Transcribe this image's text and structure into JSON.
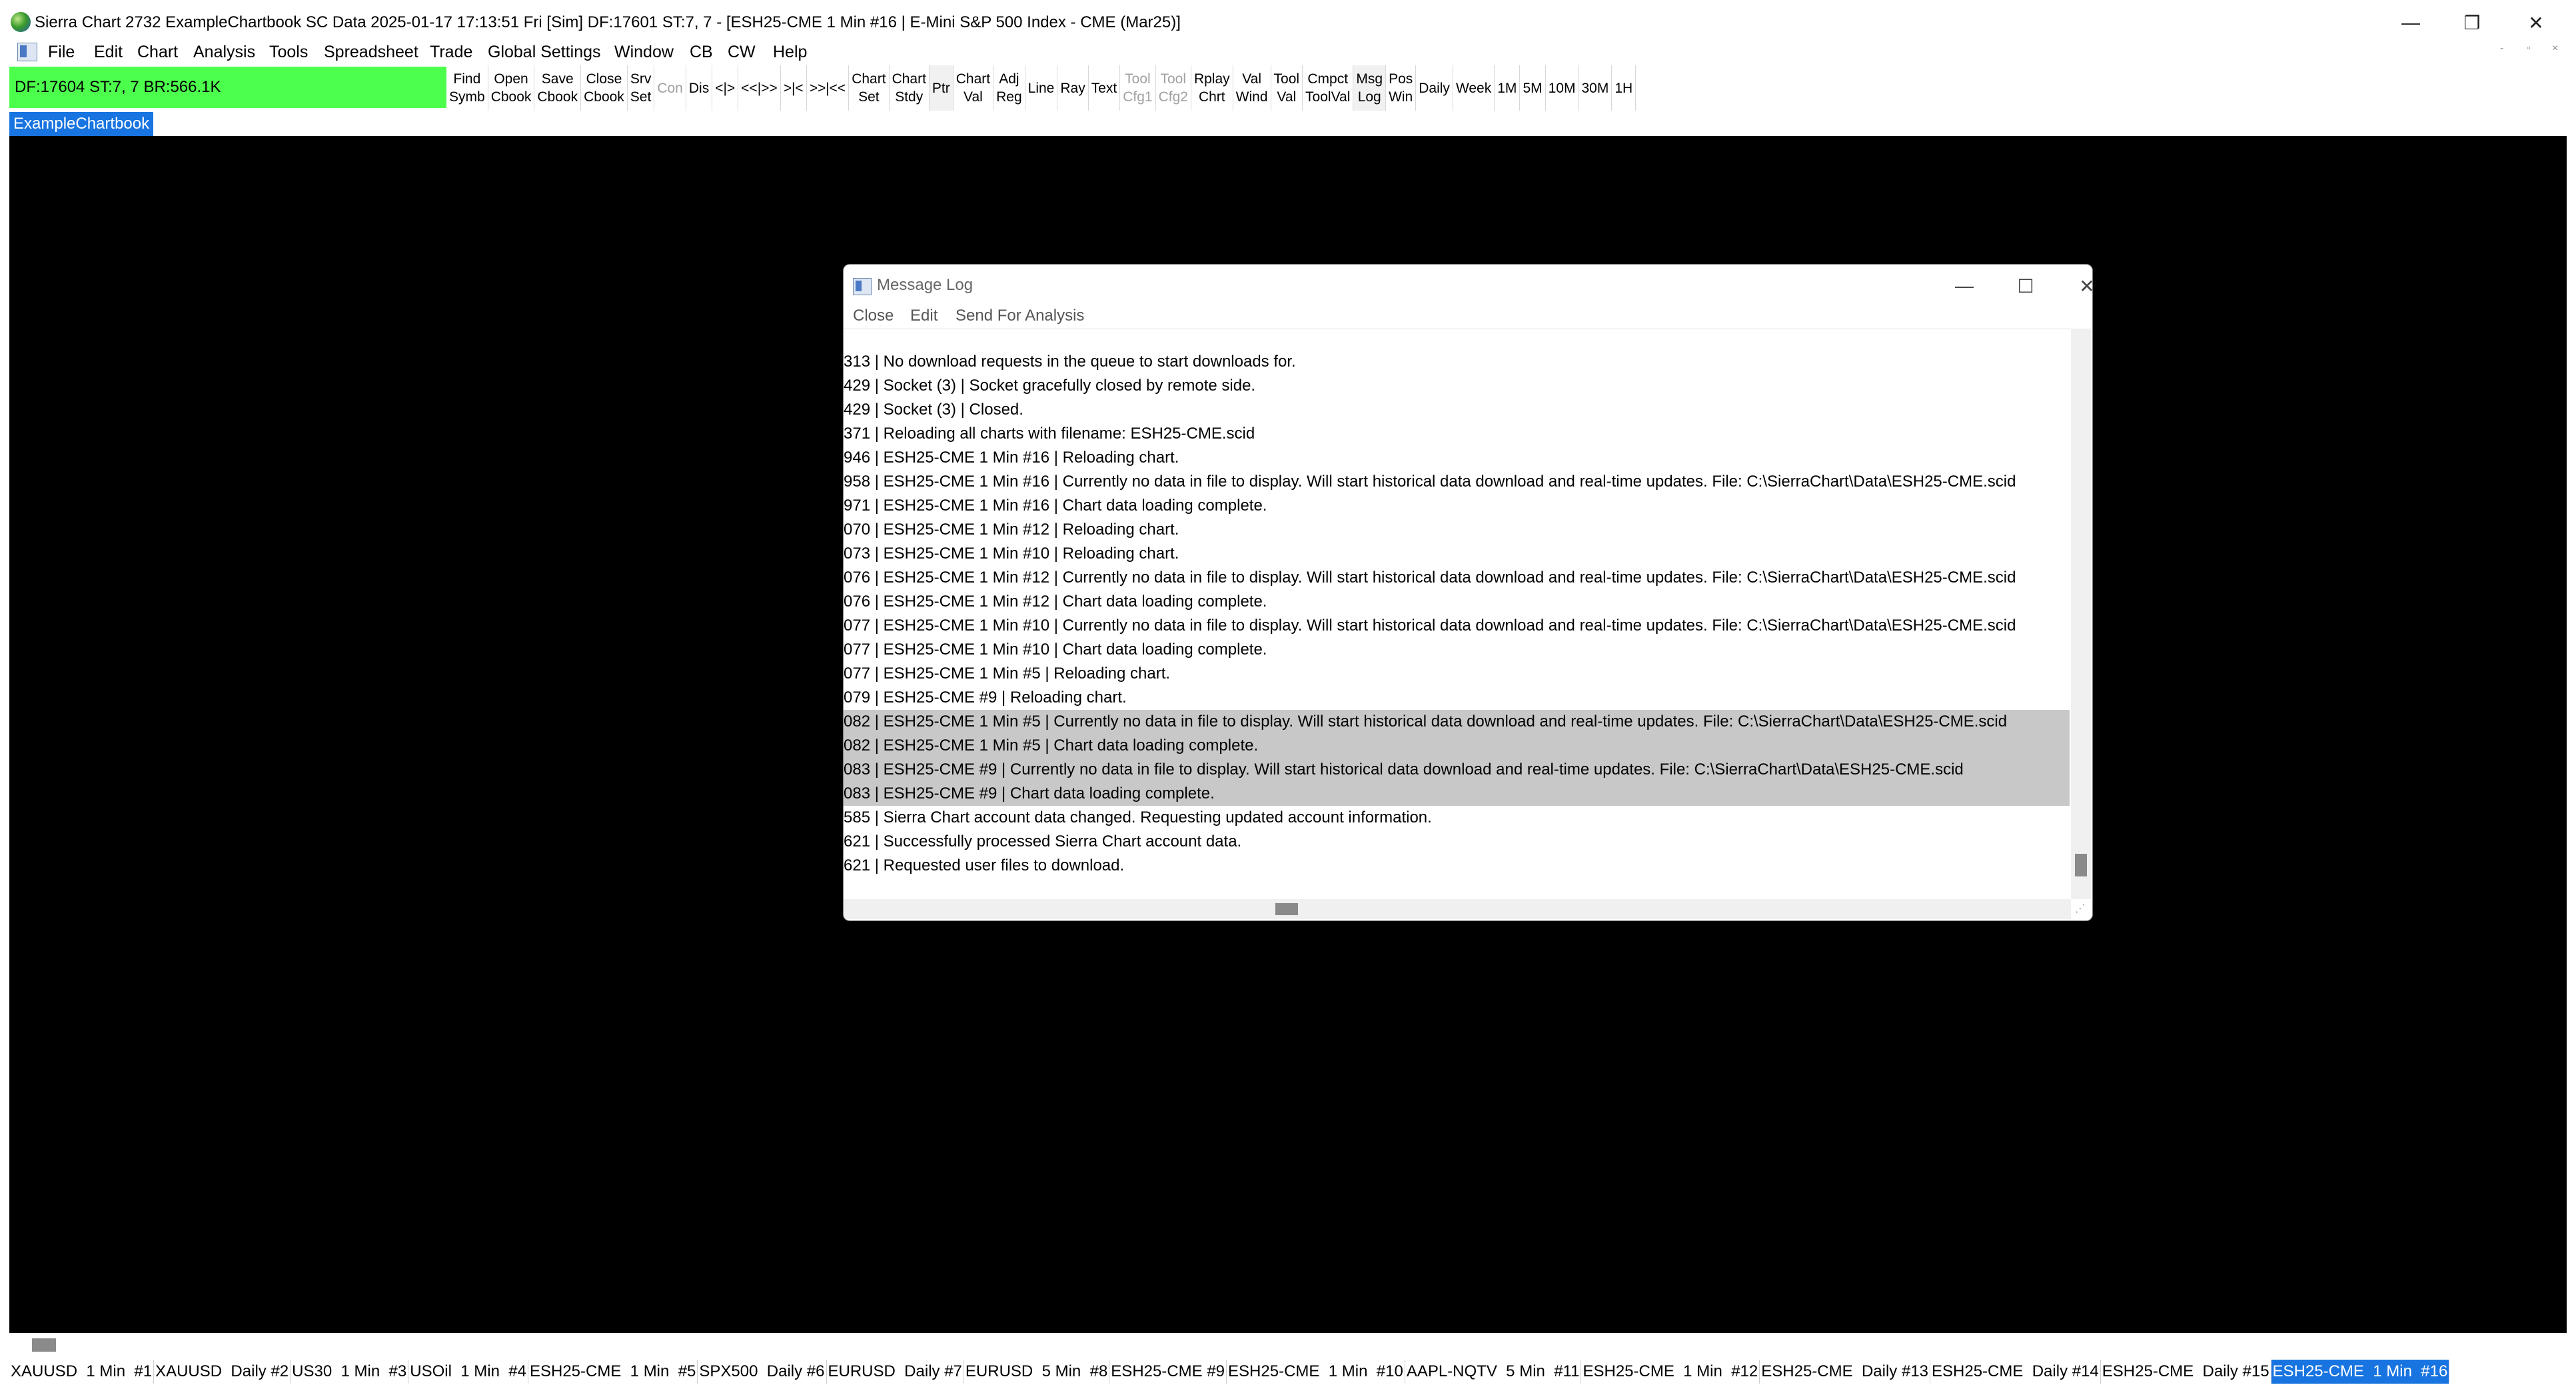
{
  "window": {
    "title": "Sierra Chart 2732 ExampleChartbook SC Data 2025-01-17  17:13:51 Fri [Sim] DF:17601  ST:7, 7 - [ESH25-CME  1 Min  #16 | E-Mini S&P 500 Index - CME (Mar25)]",
    "min_glyph": "—",
    "max_glyph": "❐",
    "close_glyph": "✕"
  },
  "menu": {
    "items": [
      "File",
      "Edit",
      "Chart",
      "Analysis",
      "Tools",
      "Spreadsheet",
      "Trade",
      "Global Settings",
      "Window",
      "CB",
      "CW",
      "Help"
    ],
    "mdi_min": "-",
    "mdi_restore": "▫",
    "mdi_close": "×"
  },
  "status": {
    "text": "DF:17604  ST:7, 7  BR:566.1K"
  },
  "toolbar": [
    {
      "label": "Find\nSymb",
      "disabled": false
    },
    {
      "label": "Open\nCbook",
      "disabled": false
    },
    {
      "label": "Save\nCbook",
      "disabled": false
    },
    {
      "label": "Close\nCbook",
      "disabled": false
    },
    {
      "label": "Srv\nSet",
      "disabled": false
    },
    {
      "label": "Con",
      "disabled": true
    },
    {
      "label": "Dis",
      "disabled": false
    },
    {
      "label": "<|>",
      "disabled": false
    },
    {
      "label": "<<|>>",
      "disabled": false
    },
    {
      "label": ">|<",
      "disabled": false
    },
    {
      "label": ">>|<<",
      "disabled": false
    },
    {
      "label": "Chart\nSet",
      "disabled": false
    },
    {
      "label": "Chart\nStdy",
      "disabled": false
    },
    {
      "label": "Ptr",
      "disabled": false,
      "pressed": true
    },
    {
      "label": "Chart\nVal",
      "disabled": false
    },
    {
      "label": "Adj\nReg",
      "disabled": false
    },
    {
      "label": "Line",
      "disabled": false
    },
    {
      "label": "Ray",
      "disabled": false
    },
    {
      "label": "Text",
      "disabled": false
    },
    {
      "label": "Tool\nCfg1",
      "disabled": true
    },
    {
      "label": "Tool\nCfg2",
      "disabled": true
    },
    {
      "label": "Rplay\nChrt",
      "disabled": false
    },
    {
      "label": "Val\nWind",
      "disabled": false
    },
    {
      "label": "Tool\nVal",
      "disabled": false
    },
    {
      "label": "Cmpct\nToolVal",
      "disabled": false
    },
    {
      "label": "Msg\nLog",
      "disabled": false,
      "pressed": true
    },
    {
      "label": "Pos\nWin",
      "disabled": false
    },
    {
      "label": "Daily",
      "disabled": false
    },
    {
      "label": "Week",
      "disabled": false
    },
    {
      "label": "1M",
      "disabled": false
    },
    {
      "label": "5M",
      "disabled": false
    },
    {
      "label": "10M",
      "disabled": false
    },
    {
      "label": "30M",
      "disabled": false
    },
    {
      "label": "1H",
      "disabled": false
    }
  ],
  "chartbook_tab": {
    "label": "ExampleChartbook"
  },
  "message_log": {
    "title": "Message Log",
    "min_glyph": "—",
    "max_glyph": "☐",
    "close_glyph": "✕",
    "menu": [
      "Close",
      "Edit",
      "Send For Analysis"
    ],
    "lines": [
      {
        "text": "313 | No download requests in the queue to start downloads for.",
        "selected": false
      },
      {
        "text": "429 | Socket (3) | Socket gracefully closed by remote side.",
        "selected": false
      },
      {
        "text": "429 | Socket (3) | Closed.",
        "selected": false
      },
      {
        "text": "371 | Reloading all charts with filename: ESH25-CME.scid",
        "selected": false
      },
      {
        "text": "946 | ESH25-CME  1 Min  #16 | Reloading chart.",
        "selected": false
      },
      {
        "text": "958 | ESH25-CME  1 Min  #16 | Currently no data in file to display. Will start historical data download and real-time updates. File: C:\\SierraChart\\Data\\ESH25-CME.scid",
        "selected": false
      },
      {
        "text": "971 | ESH25-CME  1 Min  #16 | Chart data loading complete.",
        "selected": false
      },
      {
        "text": "070 | ESH25-CME  1 Min  #12 | Reloading chart.",
        "selected": false
      },
      {
        "text": "073 | ESH25-CME  1 Min  #10 | Reloading chart.",
        "selected": false
      },
      {
        "text": "076 | ESH25-CME  1 Min  #12 | Currently no data in file to display. Will start historical data download and real-time updates. File: C:\\SierraChart\\Data\\ESH25-CME.scid",
        "selected": false
      },
      {
        "text": "076 | ESH25-CME  1 Min  #12 | Chart data loading complete.",
        "selected": false
      },
      {
        "text": "077 | ESH25-CME  1 Min  #10 | Currently no data in file to display. Will start historical data download and real-time updates. File: C:\\SierraChart\\Data\\ESH25-CME.scid",
        "selected": false
      },
      {
        "text": "077 | ESH25-CME  1 Min  #10 | Chart data loading complete.",
        "selected": false
      },
      {
        "text": "077 | ESH25-CME  1 Min  #5 | Reloading chart.",
        "selected": false
      },
      {
        "text": "079 | ESH25-CME #9 | Reloading chart.",
        "selected": false
      },
      {
        "text": "082 | ESH25-CME  1 Min  #5 | Currently no data in file to display. Will start historical data download and real-time updates. File: C:\\SierraChart\\Data\\ESH25-CME.scid",
        "selected": true
      },
      {
        "text": "082 | ESH25-CME  1 Min  #5 | Chart data loading complete.",
        "selected": true
      },
      {
        "text": "083 | ESH25-CME #9 | Currently no data in file to display. Will start historical data download and real-time updates. File: C:\\SierraChart\\Data\\ESH25-CME.scid",
        "selected": true
      },
      {
        "text": "083 | ESH25-CME #9 | Chart data loading complete.",
        "selected": true
      },
      {
        "text": "585 | Sierra Chart account data changed. Requesting updated account information.",
        "selected": false
      },
      {
        "text": "621 | Successfully processed Sierra Chart account data.",
        "selected": false
      },
      {
        "text": "621 | Requested user files to download.",
        "selected": false
      }
    ]
  },
  "chart_tabs": [
    {
      "label": "XAUUSD  1 Min  #1",
      "active": false
    },
    {
      "label": "XAUUSD  Daily #2",
      "active": false
    },
    {
      "label": "US30  1 Min  #3",
      "active": false
    },
    {
      "label": "USOil  1 Min  #4",
      "active": false
    },
    {
      "label": "ESH25-CME  1 Min  #5",
      "active": false
    },
    {
      "label": "SPX500  Daily #6",
      "active": false
    },
    {
      "label": "EURUSD  Daily #7",
      "active": false
    },
    {
      "label": "EURUSD  5 Min  #8",
      "active": false
    },
    {
      "label": "ESH25-CME #9",
      "active": false
    },
    {
      "label": "ESH25-CME  1 Min  #10",
      "active": false
    },
    {
      "label": "AAPL-NQTV  5 Min  #11",
      "active": false
    },
    {
      "label": "ESH25-CME  1 Min  #12",
      "active": false
    },
    {
      "label": "ESH25-CME  Daily #13",
      "active": false
    },
    {
      "label": "ESH25-CME  Daily #14",
      "active": false
    },
    {
      "label": "ESH25-CME  Daily #15",
      "active": false
    },
    {
      "label": "ESH25-CME  1 Min  #16",
      "active": true
    }
  ],
  "colors": {
    "status_green": "#4dff4d",
    "accent_blue": "#1874e0",
    "workspace_black": "#000000",
    "selection_gray": "#c8c8c8"
  }
}
